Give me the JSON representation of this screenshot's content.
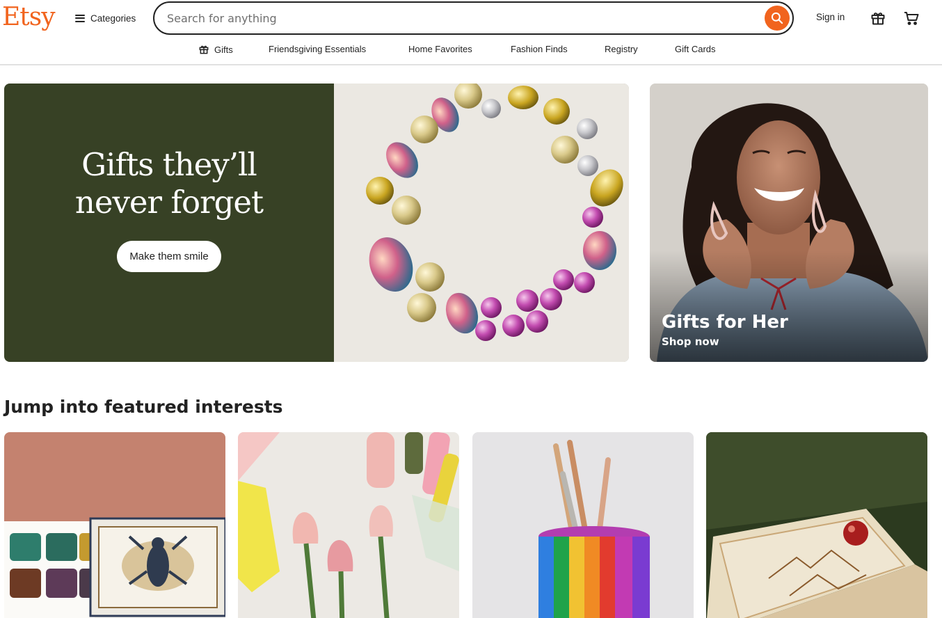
{
  "header": {
    "logo": "Etsy",
    "categories_label": "Categories",
    "search_placeholder": "Search for anything",
    "signin_label": "Sign in"
  },
  "nav": {
    "items": [
      {
        "label": "Gifts",
        "icon": "gift-icon"
      },
      {
        "label": "Friendsgiving Essentials"
      },
      {
        "label": "Home Favorites"
      },
      {
        "label": "Fashion Finds"
      },
      {
        "label": "Registry"
      },
      {
        "label": "Gift Cards"
      }
    ]
  },
  "hero": {
    "headline_line1": "Gifts they’ll",
    "headline_line2": "never forget",
    "cta_label": "Make them smile",
    "side_title": "Gifts for Her",
    "side_subtitle": "Shop now"
  },
  "featured": {
    "title": "Jump into featured interests"
  },
  "colors": {
    "brand": "#f1641e",
    "hero_bg": "#374125",
    "text": "#222222"
  }
}
